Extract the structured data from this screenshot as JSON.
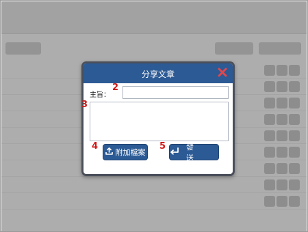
{
  "dialog": {
    "title": "分享文章",
    "subject_label": "主旨：",
    "subject_value": "",
    "body_value": "",
    "attach_label": "附加檔案",
    "send_label": "發 送",
    "close_icon": "close-x-icon",
    "colors": {
      "header": "#2c5a94",
      "button": "#2c5a94",
      "close": "#e0474c",
      "marker": "#d01818"
    }
  },
  "markers": {
    "subject": "2",
    "body": "3",
    "attach": "4",
    "send": "5"
  }
}
